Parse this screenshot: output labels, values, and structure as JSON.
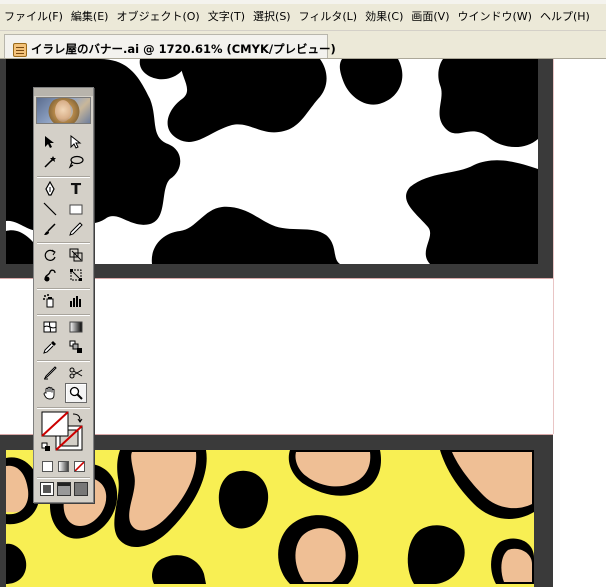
{
  "menu": {
    "items": [
      "ファイル(F)",
      "編集(E)",
      "オブジェクト(O)",
      "文字(T)",
      "選択(S)",
      "フィルタ(L)",
      "効果(C)",
      "画面(V)",
      "ウインドウ(W)",
      "ヘルプ(H)"
    ]
  },
  "document": {
    "title": "イラレ屋のバナー.ai @ 1720.61% (CMYK/プレビュー)"
  },
  "colors": {
    "chrome": "#ece9d8",
    "palette": "#d4d0c8",
    "cow_black": "#000000",
    "leopard_yellow": "#f8ef53",
    "leopard_tan": "#efbf95"
  },
  "tools": {
    "icons": [
      "selection-icon",
      "direct-selection-icon",
      "magic-wand-icon",
      "lasso-icon",
      "pen-icon",
      "type-icon",
      "line-segment-icon",
      "rectangle-icon",
      "paintbrush-icon",
      "pencil-icon",
      "rotate-icon",
      "scale-icon",
      "warp-icon",
      "free-transform-icon",
      "symbol-sprayer-icon",
      "column-graph-icon",
      "mesh-icon",
      "gradient-icon",
      "eyedropper-icon",
      "blend-icon",
      "slice-icon",
      "scissors-icon",
      "hand-icon",
      "zoom-icon",
      "fill-stroke-icon",
      "color-icon",
      "gradient-swatch-icon",
      "none-icon",
      "standard-screen-mode-icon",
      "full-screen-menu-mode-icon",
      "full-screen-mode-icon"
    ]
  }
}
